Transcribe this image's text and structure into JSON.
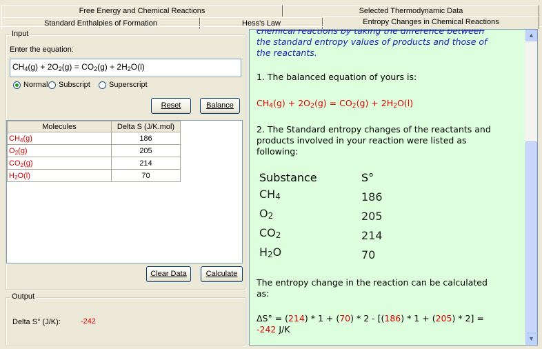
{
  "tabs": {
    "row1": [
      "Free Energy and Chemical Reactions",
      "Selected Thermodynamic Data"
    ],
    "row2": [
      "Standard Enthalpies of Formation",
      "Hess's Law",
      "Entropy Changes in Chemical Reactions"
    ]
  },
  "input": {
    "legend": "Input",
    "prompt": "Enter the equation:",
    "equation": "CH4(g) + 2O2(g) = CO2(g) + 2H2O(l)",
    "radio": [
      "Normal",
      "Subscript",
      "Superscript"
    ],
    "radio_selected": "Normal",
    "reset_label": "Reset",
    "balance_label": "Balance",
    "clear_label": "Clear Data",
    "calculate_label": "Calculate"
  },
  "grid": {
    "headers": [
      "Molecules",
      "Delta S (J/K.mol)"
    ],
    "rows": [
      {
        "molecule": "CH4(g)",
        "value": "186"
      },
      {
        "molecule": "O2(g)",
        "value": "205"
      },
      {
        "molecule": "CO2(g)",
        "value": "214"
      },
      {
        "molecule": "H2O(l)",
        "value": "70"
      }
    ]
  },
  "output": {
    "legend": "Output",
    "label": "Delta S° (J/K):",
    "value": "-242"
  },
  "explanation": {
    "intro_cut": "chemical reactions by taking the difference between",
    "intro_2": "the standard entropy values of products and those of",
    "intro_3": "the reactants.",
    "step1": "1. The balanced equation of yours is:",
    "balanced": "CH4(g) + 2O2(g) = CO2(g) + 2H2O(l)",
    "step2_a": "2. The Standard entropy changes of the reactants and",
    "step2_b": "products involved in your reaction were listed as",
    "step2_c": "following:",
    "table_headers": [
      "Substance",
      "S°"
    ],
    "table_rows": [
      {
        "substance": "CH4",
        "value": "186"
      },
      {
        "substance": "O2",
        "value": "205"
      },
      {
        "substance": "CO2",
        "value": "214"
      },
      {
        "substance": "H2O",
        "value": "70"
      }
    ],
    "calc_intro_a": "The entropy change in the reaction can be calculated",
    "calc_intro_b": "as:",
    "formula_prefix": "ΔS° = (",
    "f_v1": "214",
    "f_t1": ") * 1 + (",
    "f_v2": "70",
    "f_t2": ") * 2 - [(",
    "f_v3": "186",
    "f_t3": ") * 1 + (",
    "f_v4": "205",
    "f_t4": ") * 2] =",
    "result": "-242",
    "result_unit": " J/K"
  },
  "colors": {
    "red": "#e00000",
    "blue": "#1a1ab8",
    "panel": "#ddffdd"
  }
}
